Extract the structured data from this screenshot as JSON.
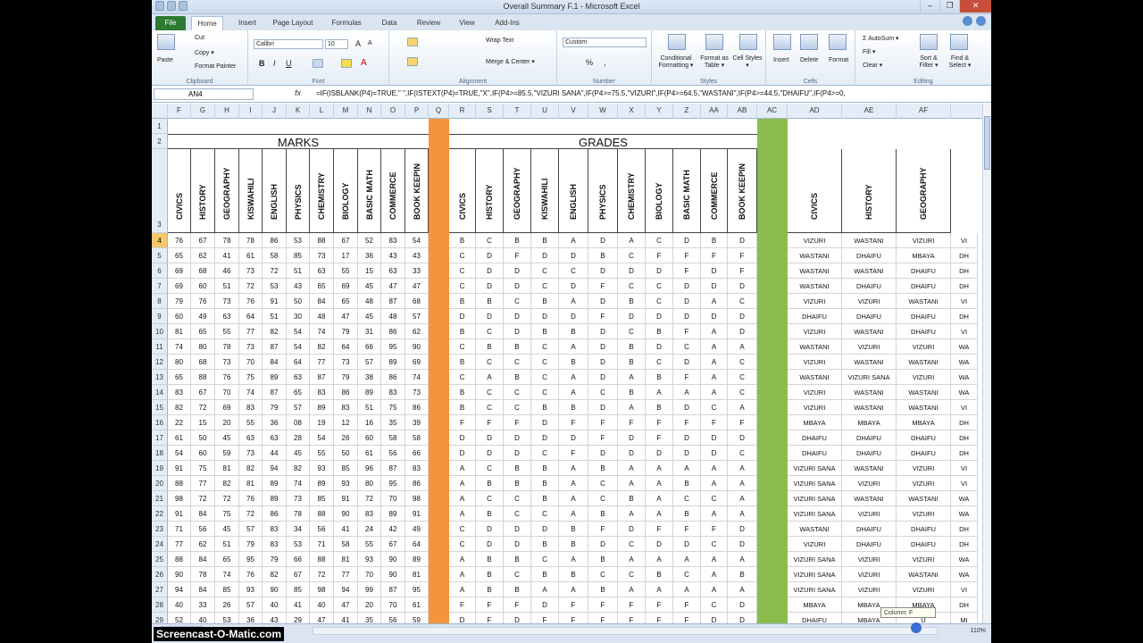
{
  "window": {
    "title": "Overall Summary F.1 - Microsoft Excel",
    "controls": [
      "–",
      "❐",
      "✕"
    ]
  },
  "tabs": [
    "File",
    "Home",
    "Insert",
    "Page Layout",
    "Formulas",
    "Data",
    "Review",
    "View",
    "Add-Ins"
  ],
  "ribbon": {
    "clipboard": {
      "paste": "Paste",
      "cut": "Cut",
      "copy": "Copy ▾",
      "format_painter": "Format Painter",
      "label": "Clipboard"
    },
    "font": {
      "name": "Calibri",
      "size": "10",
      "grow": "A",
      "shrink": "A",
      "label": "Font"
    },
    "alignment": {
      "wrap": "Wrap Text",
      "merge": "Merge & Center ▾",
      "label": "Alignment"
    },
    "number": {
      "format": "Custom",
      "percent": "%",
      "comma": ",",
      "label": "Number"
    },
    "styles": {
      "conditional": "Conditional Formatting ▾",
      "as_table": "Format as Table ▾",
      "cell": "Cell Styles ▾",
      "label": "Styles"
    },
    "cells": {
      "insert": "Insert",
      "delete": "Delete",
      "format": "Format",
      "label": "Cells"
    },
    "editing": {
      "autosum": "Σ AutoSum ▾",
      "fill": "Fill ▾",
      "clear": "Clear ▾",
      "sort": "Sort & Filter ▾",
      "find": "Find & Select ▾",
      "label": "Editing"
    }
  },
  "name_box": "AN4",
  "fx": "fx",
  "formula": "=IF(ISBLANK(P4)=TRUE,\" \",IF(ISTEXT(P4)=TRUE,\"X\",IF(P4>=85.5,\"VIZURI SANA\",IF(P4>=75.5,\"VIZURI\",IF(P4>=64.5,\"WASTANI\",IF(P4>=44.5,\"DHAIFU\",IF(P4>=0,",
  "columns": [
    "F",
    "G",
    "H",
    "I",
    "J",
    "K",
    "L",
    "M",
    "N",
    "O",
    "P",
    "Q",
    "R",
    "S",
    "T",
    "U",
    "V",
    "W",
    "X",
    "Y",
    "Z",
    "AA",
    "AB",
    "AC",
    "AD",
    "AE",
    "AF"
  ],
  "band_titles": {
    "marks": "MARKS",
    "grades": "GRADES"
  },
  "subjects": [
    "CIVICS",
    "HISTORY",
    "GEOGRAPHY",
    "KISWAHILI",
    "ENGLISH",
    "PHYSICS",
    "CHEMISTRY",
    "BIOLOGY",
    "BASIC MATH",
    "COMMERCE",
    "BOOK KEEPIN"
  ],
  "summary_subjects": [
    "CIVICS",
    "HISTORY",
    "GEOGRAPHY"
  ],
  "header_rows": [
    "1",
    "2",
    "3"
  ],
  "separator_colors": {
    "marks_gap": "#f4943c",
    "grades_gap": "#8cbc4c"
  },
  "rows": [
    {
      "n": "4",
      "marks": [
        "76",
        "67",
        "78",
        "78",
        "86",
        "53",
        "88",
        "67",
        "52",
        "83",
        "54"
      ],
      "grades": [
        "B",
        "C",
        "B",
        "B",
        "A",
        "D",
        "A",
        "C",
        "D",
        "B",
        "D"
      ],
      "summary": [
        "VIZURI",
        "WASTANI",
        "VIZURI",
        "VI"
      ]
    },
    {
      "n": "5",
      "marks": [
        "65",
        "62",
        "41",
        "61",
        "58",
        "85",
        "73",
        "17",
        "36",
        "43",
        "43"
      ],
      "grades": [
        "C",
        "D",
        "F",
        "D",
        "D",
        "B",
        "C",
        "F",
        "F",
        "F",
        "F"
      ],
      "summary": [
        "WASTANI",
        "DHAIFU",
        "MBAYA",
        "DH"
      ]
    },
    {
      "n": "6",
      "marks": [
        "69",
        "68",
        "46",
        "73",
        "72",
        "51",
        "63",
        "55",
        "15",
        "63",
        "33"
      ],
      "grades": [
        "C",
        "D",
        "D",
        "C",
        "C",
        "D",
        "D",
        "D",
        "F",
        "D",
        "F"
      ],
      "summary": [
        "WASTANI",
        "WASTANI",
        "DHAIFU",
        "DH"
      ]
    },
    {
      "n": "7",
      "marks": [
        "69",
        "60",
        "51",
        "72",
        "53",
        "43",
        "65",
        "69",
        "45",
        "47",
        "47"
      ],
      "grades": [
        "C",
        "D",
        "D",
        "C",
        "D",
        "F",
        "C",
        "C",
        "D",
        "D",
        "D"
      ],
      "summary": [
        "WASTANI",
        "DHAIFU",
        "DHAIFU",
        "DH"
      ]
    },
    {
      "n": "8",
      "marks": [
        "79",
        "76",
        "73",
        "76",
        "91",
        "50",
        "84",
        "65",
        "48",
        "87",
        "68"
      ],
      "grades": [
        "B",
        "B",
        "C",
        "B",
        "A",
        "D",
        "B",
        "C",
        "D",
        "A",
        "C"
      ],
      "summary": [
        "VIZURI",
        "VIZURI",
        "WASTANI",
        "VI"
      ]
    },
    {
      "n": "9",
      "marks": [
        "60",
        "49",
        "63",
        "64",
        "51",
        "30",
        "48",
        "47",
        "45",
        "48",
        "57"
      ],
      "grades": [
        "D",
        "D",
        "D",
        "D",
        "D",
        "F",
        "D",
        "D",
        "D",
        "D",
        "D"
      ],
      "summary": [
        "DHAIFU",
        "DHAIFU",
        "DHAIFU",
        "DH"
      ]
    },
    {
      "n": "10",
      "marks": [
        "81",
        "65",
        "55",
        "77",
        "82",
        "54",
        "74",
        "79",
        "31",
        "86",
        "62"
      ],
      "grades": [
        "B",
        "C",
        "D",
        "B",
        "B",
        "D",
        "C",
        "B",
        "F",
        "A",
        "D"
      ],
      "summary": [
        "VIZURI",
        "WASTANI",
        "DHAIFU",
        "VI"
      ]
    },
    {
      "n": "11",
      "marks": [
        "74",
        "80",
        "78",
        "73",
        "87",
        "54",
        "82",
        "64",
        "66",
        "95",
        "90"
      ],
      "grades": [
        "C",
        "B",
        "B",
        "C",
        "A",
        "D",
        "B",
        "D",
        "C",
        "A",
        "A"
      ],
      "summary": [
        "WASTANI",
        "VIZURI",
        "VIZURI",
        "WA"
      ]
    },
    {
      "n": "12",
      "marks": [
        "80",
        "68",
        "73",
        "70",
        "84",
        "64",
        "77",
        "73",
        "57",
        "89",
        "69"
      ],
      "grades": [
        "B",
        "C",
        "C",
        "C",
        "B",
        "D",
        "B",
        "C",
        "D",
        "A",
        "C"
      ],
      "summary": [
        "VIZURI",
        "WASTANI",
        "WASTANI",
        "WA"
      ]
    },
    {
      "n": "13",
      "marks": [
        "65",
        "88",
        "76",
        "75",
        "89",
        "63",
        "87",
        "79",
        "38",
        "86",
        "74"
      ],
      "grades": [
        "C",
        "A",
        "B",
        "C",
        "A",
        "D",
        "A",
        "B",
        "F",
        "A",
        "C"
      ],
      "summary": [
        "WASTANI",
        "VIZURI SANA",
        "VIZURI",
        "WA"
      ]
    },
    {
      "n": "14",
      "marks": [
        "83",
        "67",
        "70",
        "74",
        "87",
        "65",
        "83",
        "86",
        "89",
        "83",
        "73"
      ],
      "grades": [
        "B",
        "C",
        "C",
        "C",
        "A",
        "C",
        "B",
        "A",
        "A",
        "A",
        "C"
      ],
      "summary": [
        "VIZURI",
        "WASTANI",
        "WASTANI",
        "WA"
      ]
    },
    {
      "n": "15",
      "marks": [
        "82",
        "72",
        "69",
        "83",
        "79",
        "57",
        "89",
        "83",
        "51",
        "75",
        "86"
      ],
      "grades": [
        "B",
        "C",
        "C",
        "B",
        "B",
        "D",
        "A",
        "B",
        "D",
        "C",
        "A"
      ],
      "summary": [
        "VIZURI",
        "WASTANI",
        "WASTANI",
        "VI"
      ]
    },
    {
      "n": "16",
      "marks": [
        "22",
        "15",
        "20",
        "55",
        "36",
        "08",
        "19",
        "12",
        "16",
        "35",
        "39"
      ],
      "grades": [
        "F",
        "F",
        "F",
        "D",
        "F",
        "F",
        "F",
        "F",
        "F",
        "F",
        "F"
      ],
      "summary": [
        "MBAYA",
        "MBAYA",
        "MBAYA",
        "DH"
      ]
    },
    {
      "n": "17",
      "marks": [
        "61",
        "50",
        "45",
        "63",
        "63",
        "28",
        "54",
        "26",
        "60",
        "58",
        "58"
      ],
      "grades": [
        "D",
        "D",
        "D",
        "D",
        "D",
        "F",
        "D",
        "F",
        "D",
        "D",
        "D"
      ],
      "summary": [
        "DHAIFU",
        "DHAIFU",
        "DHAIFU",
        "DH"
      ]
    },
    {
      "n": "18",
      "marks": [
        "54",
        "60",
        "59",
        "73",
        "44",
        "45",
        "55",
        "50",
        "61",
        "56",
        "66"
      ],
      "grades": [
        "D",
        "D",
        "D",
        "C",
        "F",
        "D",
        "D",
        "D",
        "D",
        "D",
        "C"
      ],
      "summary": [
        "DHAIFU",
        "DHAIFU",
        "DHAIFU",
        "DH"
      ]
    },
    {
      "n": "19",
      "marks": [
        "91",
        "75",
        "81",
        "82",
        "94",
        "82",
        "93",
        "85",
        "96",
        "87",
        "83"
      ],
      "grades": [
        "A",
        "C",
        "B",
        "B",
        "A",
        "B",
        "A",
        "A",
        "A",
        "A",
        "A"
      ],
      "summary": [
        "VIZURI SANA",
        "WASTANI",
        "VIZURI",
        "VI"
      ]
    },
    {
      "n": "20",
      "marks": [
        "88",
        "77",
        "82",
        "81",
        "89",
        "74",
        "89",
        "93",
        "80",
        "95",
        "86"
      ],
      "grades": [
        "A",
        "B",
        "B",
        "B",
        "A",
        "C",
        "A",
        "A",
        "B",
        "A",
        "A"
      ],
      "summary": [
        "VIZURI SANA",
        "VIZURI",
        "VIZURI",
        "VI"
      ]
    },
    {
      "n": "21",
      "marks": [
        "98",
        "72",
        "72",
        "76",
        "89",
        "73",
        "85",
        "91",
        "72",
        "70",
        "98"
      ],
      "grades": [
        "A",
        "C",
        "C",
        "B",
        "A",
        "C",
        "B",
        "A",
        "C",
        "C",
        "A"
      ],
      "summary": [
        "VIZURI SANA",
        "WASTANI",
        "WASTANI",
        "WA"
      ]
    },
    {
      "n": "22",
      "marks": [
        "91",
        "84",
        "75",
        "72",
        "86",
        "78",
        "88",
        "90",
        "83",
        "89",
        "91"
      ],
      "grades": [
        "A",
        "B",
        "C",
        "C",
        "A",
        "B",
        "A",
        "A",
        "B",
        "A",
        "A"
      ],
      "summary": [
        "VIZURI SANA",
        "VIZURI",
        "VIZURI",
        "WA"
      ]
    },
    {
      "n": "23",
      "marks": [
        "71",
        "56",
        "45",
        "57",
        "83",
        "34",
        "56",
        "41",
        "24",
        "42",
        "49"
      ],
      "grades": [
        "C",
        "D",
        "D",
        "D",
        "B",
        "F",
        "D",
        "F",
        "F",
        "F",
        "D"
      ],
      "summary": [
        "WASTANI",
        "DHAIFU",
        "DHAIFU",
        "DH"
      ]
    },
    {
      "n": "24",
      "marks": [
        "77",
        "62",
        "51",
        "79",
        "83",
        "53",
        "71",
        "58",
        "55",
        "67",
        "64"
      ],
      "grades": [
        "C",
        "D",
        "D",
        "B",
        "B",
        "D",
        "C",
        "D",
        "D",
        "C",
        "D"
      ],
      "summary": [
        "VIZURI",
        "DHAIFU",
        "DHAIFU",
        "DH"
      ]
    },
    {
      "n": "25",
      "marks": [
        "88",
        "84",
        "65",
        "95",
        "79",
        "66",
        "88",
        "81",
        "93",
        "90",
        "89"
      ],
      "grades": [
        "A",
        "B",
        "B",
        "C",
        "A",
        "B",
        "A",
        "A",
        "A",
        "A",
        "A"
      ],
      "summary": [
        "VIZURI SANA",
        "VIZURI",
        "VIZURI",
        "WA"
      ]
    },
    {
      "n": "26",
      "marks": [
        "90",
        "78",
        "74",
        "76",
        "82",
        "67",
        "72",
        "77",
        "70",
        "90",
        "81"
      ],
      "grades": [
        "A",
        "B",
        "C",
        "B",
        "B",
        "C",
        "C",
        "B",
        "C",
        "A",
        "B"
      ],
      "summary": [
        "VIZURI SANA",
        "VIZURI",
        "WASTANI",
        "WA"
      ]
    },
    {
      "n": "27",
      "marks": [
        "94",
        "84",
        "85",
        "93",
        "90",
        "85",
        "98",
        "94",
        "99",
        "87",
        "95"
      ],
      "grades": [
        "A",
        "B",
        "B",
        "A",
        "A",
        "B",
        "A",
        "A",
        "A",
        "A",
        "A"
      ],
      "summary": [
        "VIZURI SANA",
        "VIZURI",
        "VIZURI",
        "VI"
      ]
    },
    {
      "n": "28",
      "marks": [
        "40",
        "33",
        "26",
        "57",
        "40",
        "41",
        "40",
        "47",
        "20",
        "70",
        "61"
      ],
      "grades": [
        "F",
        "F",
        "F",
        "D",
        "F",
        "F",
        "F",
        "F",
        "F",
        "C",
        "D"
      ],
      "summary": [
        "MBAYA",
        "MBAYA",
        "MBAYA",
        "DH"
      ]
    },
    {
      "n": "29",
      "marks": [
        "52",
        "40",
        "53",
        "36",
        "43",
        "29",
        "47",
        "41",
        "35",
        "56",
        "59"
      ],
      "grades": [
        "D",
        "F",
        "D",
        "F",
        "F",
        "F",
        "F",
        "F",
        "F",
        "D",
        "D"
      ],
      "summary": [
        "DHAIFU",
        "MBAYA",
        "U",
        "MI"
      ]
    }
  ],
  "tooltip": "Column: F",
  "watermark": "Screencast-O-Matic.com",
  "zoom": "110%"
}
